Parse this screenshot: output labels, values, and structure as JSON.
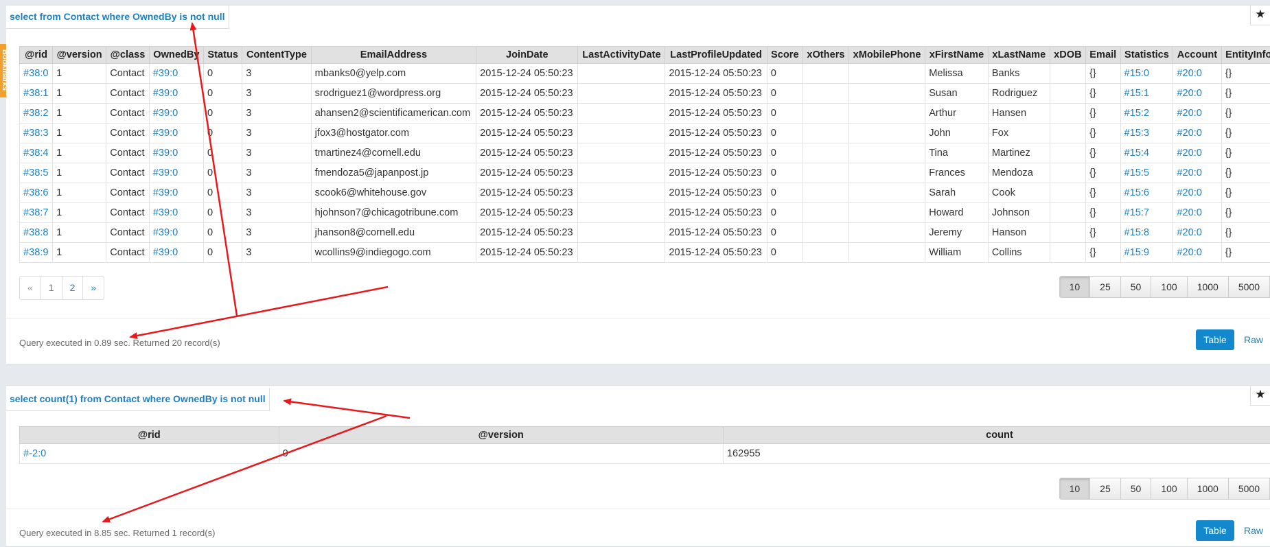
{
  "sidebar": {
    "bookmarks_label": "Bookmarks"
  },
  "query1": {
    "title": "select from Contact where OwnedBy is not null",
    "star": "★",
    "columns": [
      "@rid",
      "@version",
      "@class",
      "OwnedBy",
      "Status",
      "ContentType",
      "EmailAddress",
      "JoinDate",
      "LastActivityDate",
      "LastProfileUpdated",
      "Score",
      "xOthers",
      "xMobilePhone",
      "xFirstName",
      "xLastName",
      "xDOB",
      "Email",
      "Statistics",
      "Account",
      "EntityInfo"
    ],
    "rows": [
      [
        "#38:0",
        "1",
        "Contact",
        "#39:0",
        "0",
        "3",
        "mbanks0@yelp.com",
        "2015-12-24 05:50:23",
        "",
        "2015-12-24 05:50:23",
        "0",
        "",
        "",
        "Melissa",
        "Banks",
        "",
        "{}",
        "#15:0",
        "#20:0",
        "{}"
      ],
      [
        "#38:1",
        "1",
        "Contact",
        "#39:0",
        "0",
        "3",
        "srodriguez1@wordpress.org",
        "2015-12-24 05:50:23",
        "",
        "2015-12-24 05:50:23",
        "0",
        "",
        "",
        "Susan",
        "Rodriguez",
        "",
        "{}",
        "#15:1",
        "#20:0",
        "{}"
      ],
      [
        "#38:2",
        "1",
        "Contact",
        "#39:0",
        "0",
        "3",
        "ahansen2@scientificamerican.com",
        "2015-12-24 05:50:23",
        "",
        "2015-12-24 05:50:23",
        "0",
        "",
        "",
        "Arthur",
        "Hansen",
        "",
        "{}",
        "#15:2",
        "#20:0",
        "{}"
      ],
      [
        "#38:3",
        "1",
        "Contact",
        "#39:0",
        "0",
        "3",
        "jfox3@hostgator.com",
        "2015-12-24 05:50:23",
        "",
        "2015-12-24 05:50:23",
        "0",
        "",
        "",
        "John",
        "Fox",
        "",
        "{}",
        "#15:3",
        "#20:0",
        "{}"
      ],
      [
        "#38:4",
        "1",
        "Contact",
        "#39:0",
        "0",
        "3",
        "tmartinez4@cornell.edu",
        "2015-12-24 05:50:23",
        "",
        "2015-12-24 05:50:23",
        "0",
        "",
        "",
        "Tina",
        "Martinez",
        "",
        "{}",
        "#15:4",
        "#20:0",
        "{}"
      ],
      [
        "#38:5",
        "1",
        "Contact",
        "#39:0",
        "0",
        "3",
        "fmendoza5@japanpost.jp",
        "2015-12-24 05:50:23",
        "",
        "2015-12-24 05:50:23",
        "0",
        "",
        "",
        "Frances",
        "Mendoza",
        "",
        "{}",
        "#15:5",
        "#20:0",
        "{}"
      ],
      [
        "#38:6",
        "1",
        "Contact",
        "#39:0",
        "0",
        "3",
        "scook6@whitehouse.gov",
        "2015-12-24 05:50:23",
        "",
        "2015-12-24 05:50:23",
        "0",
        "",
        "",
        "Sarah",
        "Cook",
        "",
        "{}",
        "#15:6",
        "#20:0",
        "{}"
      ],
      [
        "#38:7",
        "1",
        "Contact",
        "#39:0",
        "0",
        "3",
        "hjohnson7@chicagotribune.com",
        "2015-12-24 05:50:23",
        "",
        "2015-12-24 05:50:23",
        "0",
        "",
        "",
        "Howard",
        "Johnson",
        "",
        "{}",
        "#15:7",
        "#20:0",
        "{}"
      ],
      [
        "#38:8",
        "1",
        "Contact",
        "#39:0",
        "0",
        "3",
        "jhanson8@cornell.edu",
        "2015-12-24 05:50:23",
        "",
        "2015-12-24 05:50:23",
        "0",
        "",
        "",
        "Jeremy",
        "Hanson",
        "",
        "{}",
        "#15:8",
        "#20:0",
        "{}"
      ],
      [
        "#38:9",
        "1",
        "Contact",
        "#39:0",
        "0",
        "3",
        "wcollins9@indiegogo.com",
        "2015-12-24 05:50:23",
        "",
        "2015-12-24 05:50:23",
        "0",
        "",
        "",
        "William",
        "Collins",
        "",
        "{}",
        "#15:9",
        "#20:0",
        "{}"
      ]
    ],
    "pager": {
      "prev": "«",
      "pages": [
        "1",
        "2"
      ],
      "next": "»"
    },
    "page_sizes": [
      "10",
      "25",
      "50",
      "100",
      "1000",
      "5000"
    ],
    "active_page_size": "10",
    "status": "Query executed in 0.89 sec. Returned 20 record(s)",
    "view_table": "Table",
    "view_raw": "Raw"
  },
  "query2": {
    "title": "select count(1) from Contact where OwnedBy is not null",
    "star": "★",
    "columns": [
      "@rid",
      "@version",
      "count"
    ],
    "rows": [
      [
        "#-2:0",
        "0",
        "162955"
      ]
    ],
    "page_sizes": [
      "10",
      "25",
      "50",
      "100",
      "1000",
      "5000"
    ],
    "active_page_size": "10",
    "status": "Query executed in 8.85 sec. Returned 1 record(s)",
    "view_table": "Table",
    "view_raw": "Raw"
  },
  "colors": {
    "link": "#1d80c3",
    "header_bg": "#e1e1e1",
    "primary_button": "#1388cc",
    "annotation_arrow": "#e8191c",
    "bookmarks_tab": "#f0a02e"
  }
}
